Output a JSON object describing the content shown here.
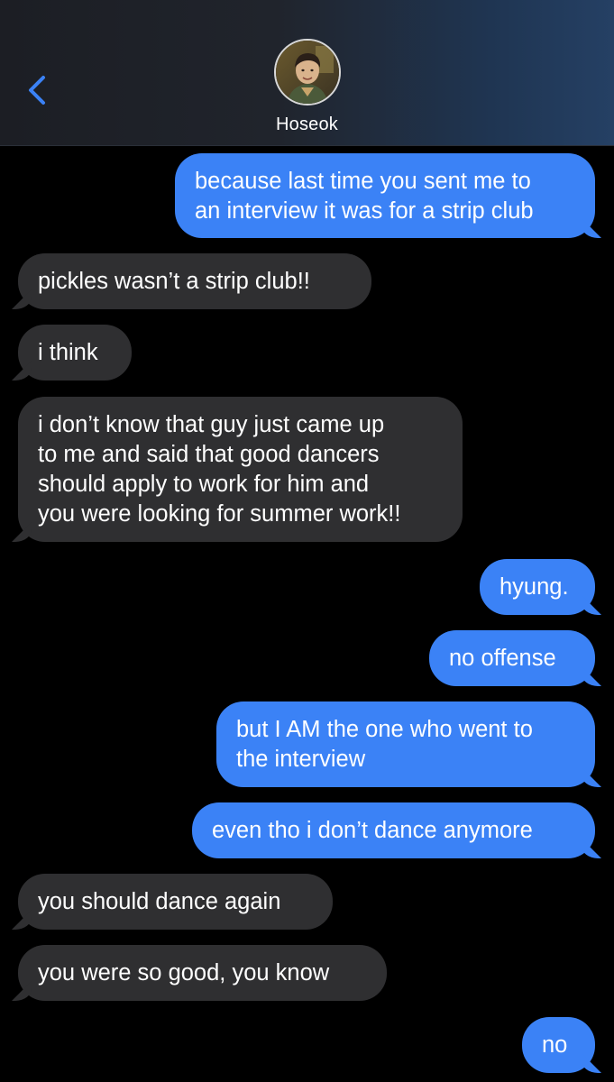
{
  "header": {
    "contact_name": "Hoseok",
    "back_icon": "chevron-left-icon",
    "accent_color": "#3b82f6"
  },
  "messages": [
    {
      "from": "me",
      "lines": [
        "because last time you sent me to",
        "an interview it was for a strip club"
      ]
    },
    {
      "from": "them",
      "lines": [
        "pickles wasn’t a strip club!!"
      ]
    },
    {
      "from": "them",
      "lines": [
        "i think"
      ]
    },
    {
      "from": "them",
      "lines": [
        "i don’t know that guy just came up",
        "to me and said that good dancers",
        "should apply to work for him and",
        "you were looking for summer work!!"
      ]
    },
    {
      "from": "me",
      "lines": [
        "hyung."
      ]
    },
    {
      "from": "me",
      "lines": [
        "no offense"
      ]
    },
    {
      "from": "me",
      "lines": [
        "but I AM the one who went to",
        "the interview"
      ]
    },
    {
      "from": "me",
      "lines": [
        "even tho i don’t dance anymore"
      ]
    },
    {
      "from": "them",
      "lines": [
        "you should dance again"
      ]
    },
    {
      "from": "them",
      "lines": [
        "you were so good, you know"
      ]
    },
    {
      "from": "me",
      "lines": [
        "no"
      ]
    }
  ]
}
